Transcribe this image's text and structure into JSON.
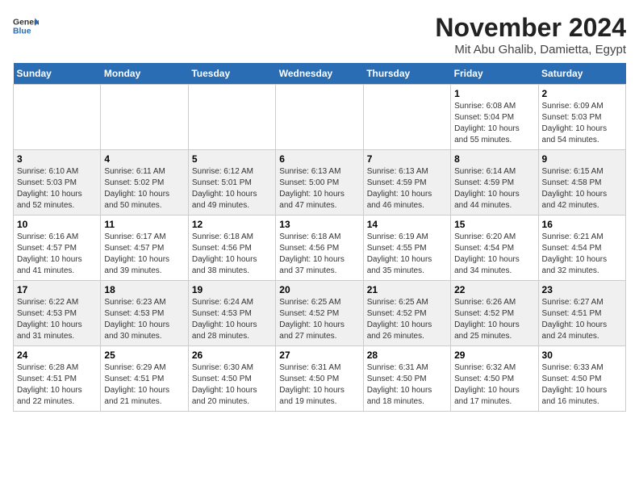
{
  "header": {
    "logo_general": "General",
    "logo_blue": "Blue",
    "title": "November 2024",
    "subtitle": "Mit Abu Ghalib, Damietta, Egypt"
  },
  "weekdays": [
    "Sunday",
    "Monday",
    "Tuesday",
    "Wednesday",
    "Thursday",
    "Friday",
    "Saturday"
  ],
  "weeks": [
    [
      {
        "day": "",
        "info": ""
      },
      {
        "day": "",
        "info": ""
      },
      {
        "day": "",
        "info": ""
      },
      {
        "day": "",
        "info": ""
      },
      {
        "day": "",
        "info": ""
      },
      {
        "day": "1",
        "info": "Sunrise: 6:08 AM\nSunset: 5:04 PM\nDaylight: 10 hours and 55 minutes."
      },
      {
        "day": "2",
        "info": "Sunrise: 6:09 AM\nSunset: 5:03 PM\nDaylight: 10 hours and 54 minutes."
      }
    ],
    [
      {
        "day": "3",
        "info": "Sunrise: 6:10 AM\nSunset: 5:03 PM\nDaylight: 10 hours and 52 minutes."
      },
      {
        "day": "4",
        "info": "Sunrise: 6:11 AM\nSunset: 5:02 PM\nDaylight: 10 hours and 50 minutes."
      },
      {
        "day": "5",
        "info": "Sunrise: 6:12 AM\nSunset: 5:01 PM\nDaylight: 10 hours and 49 minutes."
      },
      {
        "day": "6",
        "info": "Sunrise: 6:13 AM\nSunset: 5:00 PM\nDaylight: 10 hours and 47 minutes."
      },
      {
        "day": "7",
        "info": "Sunrise: 6:13 AM\nSunset: 4:59 PM\nDaylight: 10 hours and 46 minutes."
      },
      {
        "day": "8",
        "info": "Sunrise: 6:14 AM\nSunset: 4:59 PM\nDaylight: 10 hours and 44 minutes."
      },
      {
        "day": "9",
        "info": "Sunrise: 6:15 AM\nSunset: 4:58 PM\nDaylight: 10 hours and 42 minutes."
      }
    ],
    [
      {
        "day": "10",
        "info": "Sunrise: 6:16 AM\nSunset: 4:57 PM\nDaylight: 10 hours and 41 minutes."
      },
      {
        "day": "11",
        "info": "Sunrise: 6:17 AM\nSunset: 4:57 PM\nDaylight: 10 hours and 39 minutes."
      },
      {
        "day": "12",
        "info": "Sunrise: 6:18 AM\nSunset: 4:56 PM\nDaylight: 10 hours and 38 minutes."
      },
      {
        "day": "13",
        "info": "Sunrise: 6:18 AM\nSunset: 4:56 PM\nDaylight: 10 hours and 37 minutes."
      },
      {
        "day": "14",
        "info": "Sunrise: 6:19 AM\nSunset: 4:55 PM\nDaylight: 10 hours and 35 minutes."
      },
      {
        "day": "15",
        "info": "Sunrise: 6:20 AM\nSunset: 4:54 PM\nDaylight: 10 hours and 34 minutes."
      },
      {
        "day": "16",
        "info": "Sunrise: 6:21 AM\nSunset: 4:54 PM\nDaylight: 10 hours and 32 minutes."
      }
    ],
    [
      {
        "day": "17",
        "info": "Sunrise: 6:22 AM\nSunset: 4:53 PM\nDaylight: 10 hours and 31 minutes."
      },
      {
        "day": "18",
        "info": "Sunrise: 6:23 AM\nSunset: 4:53 PM\nDaylight: 10 hours and 30 minutes."
      },
      {
        "day": "19",
        "info": "Sunrise: 6:24 AM\nSunset: 4:53 PM\nDaylight: 10 hours and 28 minutes."
      },
      {
        "day": "20",
        "info": "Sunrise: 6:25 AM\nSunset: 4:52 PM\nDaylight: 10 hours and 27 minutes."
      },
      {
        "day": "21",
        "info": "Sunrise: 6:25 AM\nSunset: 4:52 PM\nDaylight: 10 hours and 26 minutes."
      },
      {
        "day": "22",
        "info": "Sunrise: 6:26 AM\nSunset: 4:52 PM\nDaylight: 10 hours and 25 minutes."
      },
      {
        "day": "23",
        "info": "Sunrise: 6:27 AM\nSunset: 4:51 PM\nDaylight: 10 hours and 24 minutes."
      }
    ],
    [
      {
        "day": "24",
        "info": "Sunrise: 6:28 AM\nSunset: 4:51 PM\nDaylight: 10 hours and 22 minutes."
      },
      {
        "day": "25",
        "info": "Sunrise: 6:29 AM\nSunset: 4:51 PM\nDaylight: 10 hours and 21 minutes."
      },
      {
        "day": "26",
        "info": "Sunrise: 6:30 AM\nSunset: 4:50 PM\nDaylight: 10 hours and 20 minutes."
      },
      {
        "day": "27",
        "info": "Sunrise: 6:31 AM\nSunset: 4:50 PM\nDaylight: 10 hours and 19 minutes."
      },
      {
        "day": "28",
        "info": "Sunrise: 6:31 AM\nSunset: 4:50 PM\nDaylight: 10 hours and 18 minutes."
      },
      {
        "day": "29",
        "info": "Sunrise: 6:32 AM\nSunset: 4:50 PM\nDaylight: 10 hours and 17 minutes."
      },
      {
        "day": "30",
        "info": "Sunrise: 6:33 AM\nSunset: 4:50 PM\nDaylight: 10 hours and 16 minutes."
      }
    ]
  ]
}
